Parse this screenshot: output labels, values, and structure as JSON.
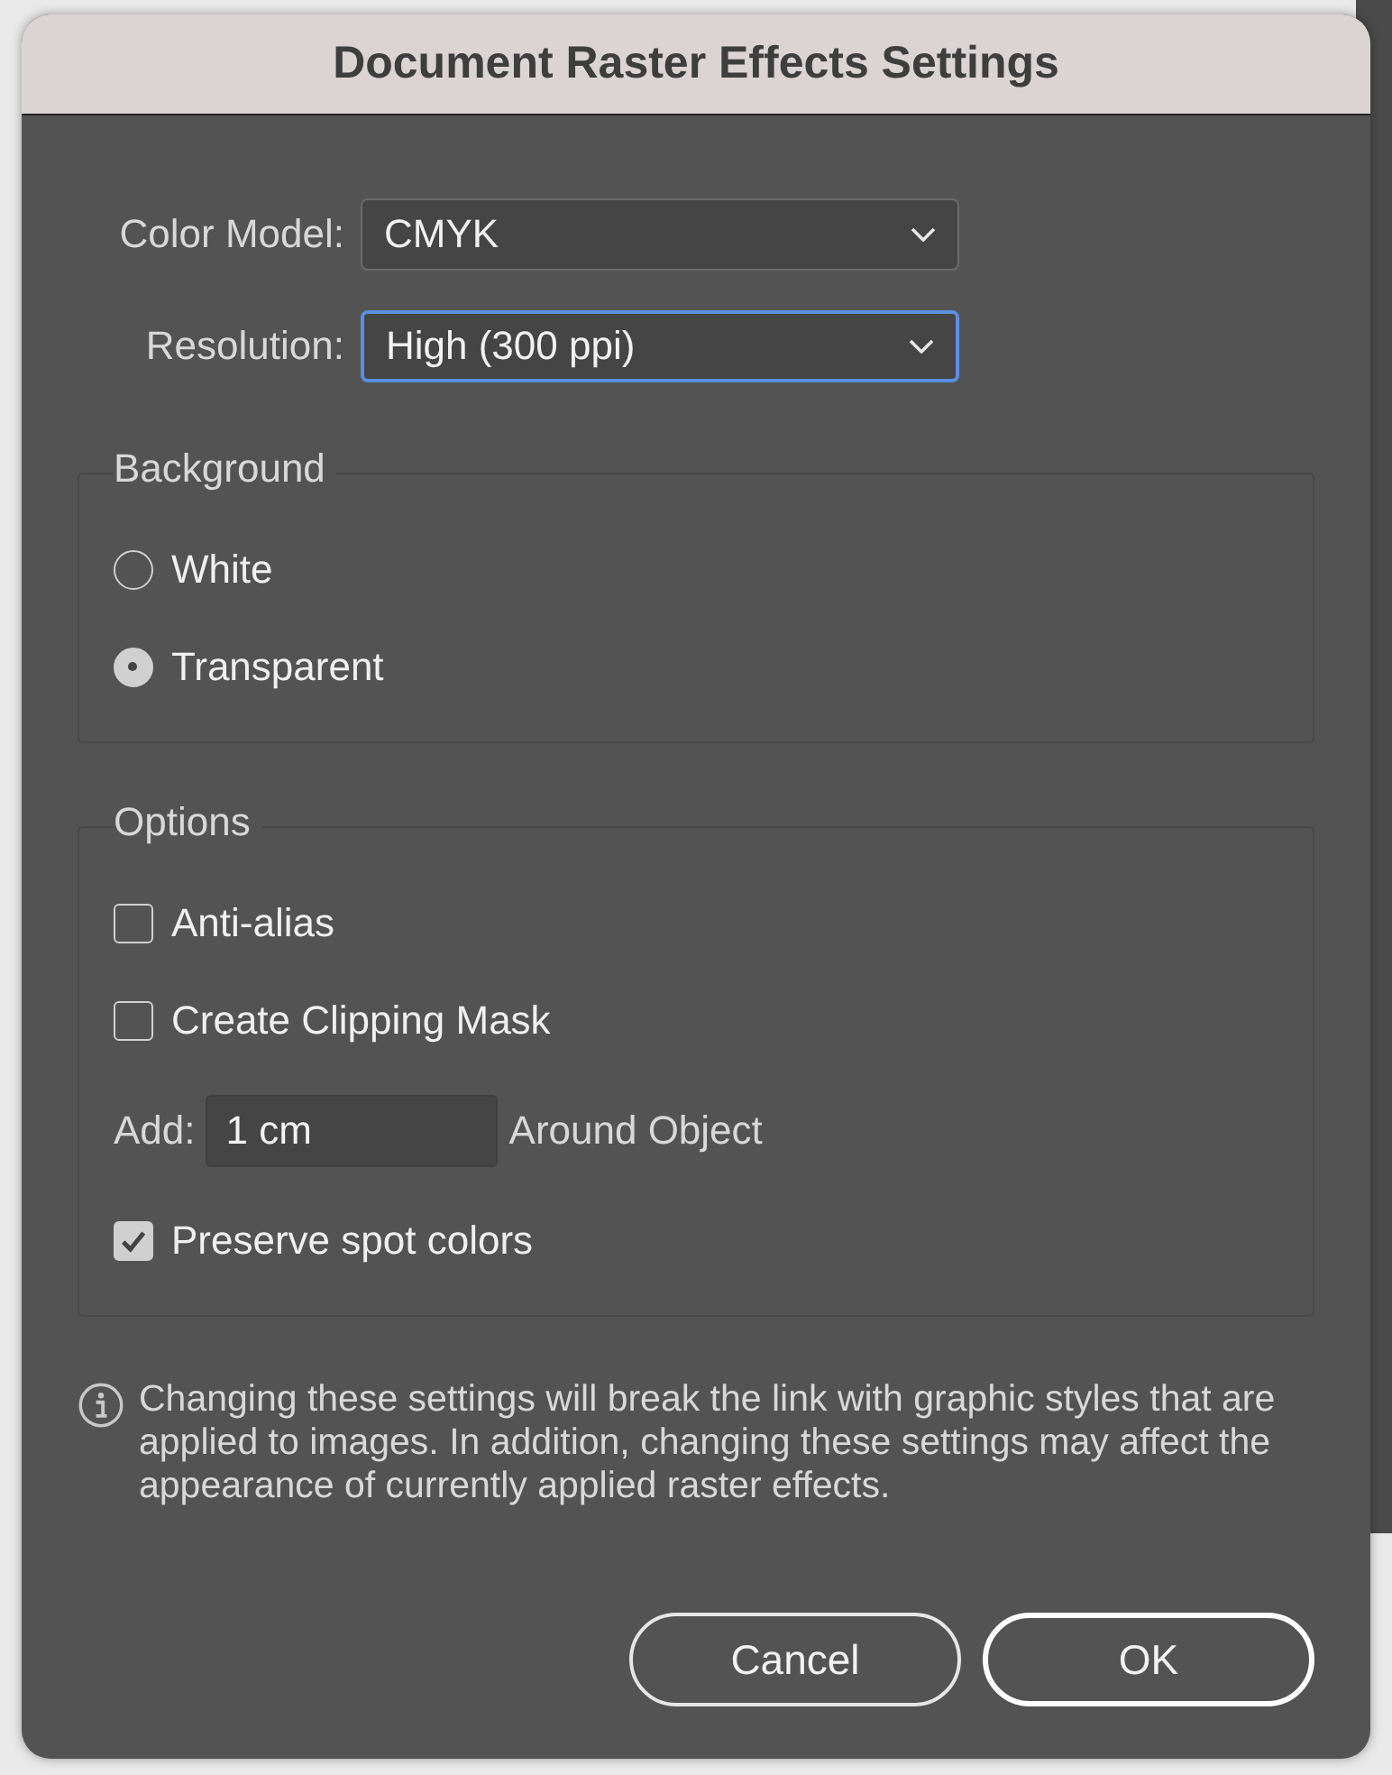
{
  "window": {
    "title": "Document Raster Effects Settings"
  },
  "fields": [
    {
      "label": "Color Model:",
      "value": "CMYK",
      "focused": false
    },
    {
      "label": "Resolution:",
      "value": "High (300 ppi)",
      "focused": true
    }
  ],
  "background": {
    "title": "Background",
    "options": [
      {
        "label": "White",
        "selected": false
      },
      {
        "label": "Transparent",
        "selected": true
      }
    ]
  },
  "options": {
    "title": "Options",
    "items": [
      {
        "kind": "checkbox",
        "label": "Anti-alias",
        "checked": false
      },
      {
        "kind": "checkbox",
        "label": "Create Clipping Mask",
        "checked": false
      },
      {
        "kind": "add",
        "label": "Add:",
        "value": "1 cm",
        "suffix": "Around Object"
      },
      {
        "kind": "checkbox",
        "label": "Preserve spot colors",
        "checked": true
      }
    ]
  },
  "note": "Changing these settings will break the link with graphic styles that are applied to images. In addition, changing these settings may affect the appearance of currently applied raster effects.",
  "buttons": [
    {
      "label": "Cancel",
      "default": false
    },
    {
      "label": "OK",
      "default": true
    }
  ]
}
